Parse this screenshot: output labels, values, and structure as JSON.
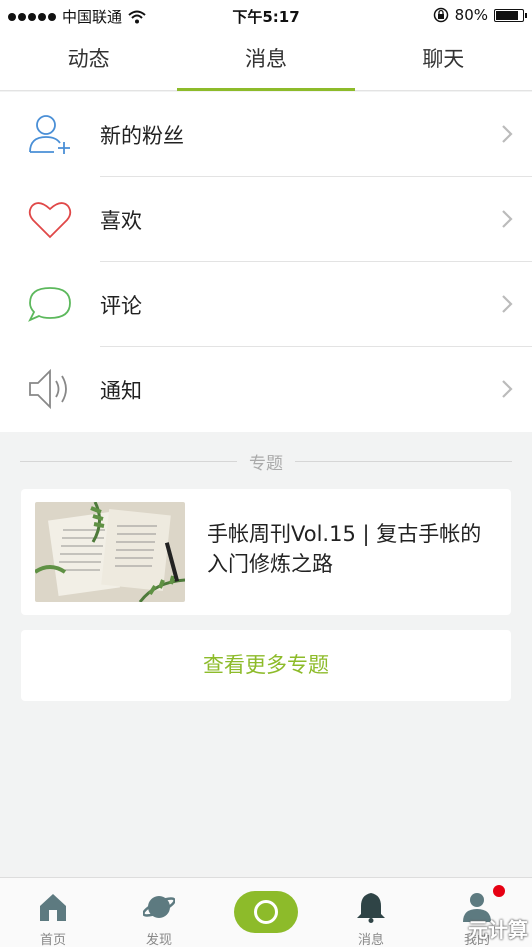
{
  "status_bar": {
    "carrier": "中国联通",
    "time": "下午5:17",
    "battery_text": "80%",
    "battery_level": 0.8
  },
  "tabs": [
    {
      "label": "动态",
      "active": false
    },
    {
      "label": "消息",
      "active": true
    },
    {
      "label": "聊天",
      "active": false
    }
  ],
  "menu": [
    {
      "label": "新的粉丝",
      "icon": "new-follower-icon"
    },
    {
      "label": "喜欢",
      "icon": "heart-icon"
    },
    {
      "label": "评论",
      "icon": "comment-bubble-icon"
    },
    {
      "label": "通知",
      "icon": "speaker-icon"
    }
  ],
  "section": {
    "title": "专题"
  },
  "topic": {
    "title": "手帐周刊Vol.15 | 复古手帐的入门修炼之路"
  },
  "more_button": {
    "label": "查看更多专题"
  },
  "bottom_nav": [
    {
      "label": "首页",
      "icon": "home-icon"
    },
    {
      "label": "发现",
      "icon": "planet-icon"
    },
    {
      "label": "",
      "icon": "record-icon"
    },
    {
      "label": "消息",
      "icon": "bell-icon",
      "active": true
    },
    {
      "label": "我的",
      "icon": "profile-icon"
    }
  ],
  "watermark": "元计算",
  "colors": {
    "accent": "#8dbb2a",
    "heart": "#e04848",
    "comment": "#5cb85c",
    "follower": "#4a8fd6",
    "badge": "#e60012"
  }
}
